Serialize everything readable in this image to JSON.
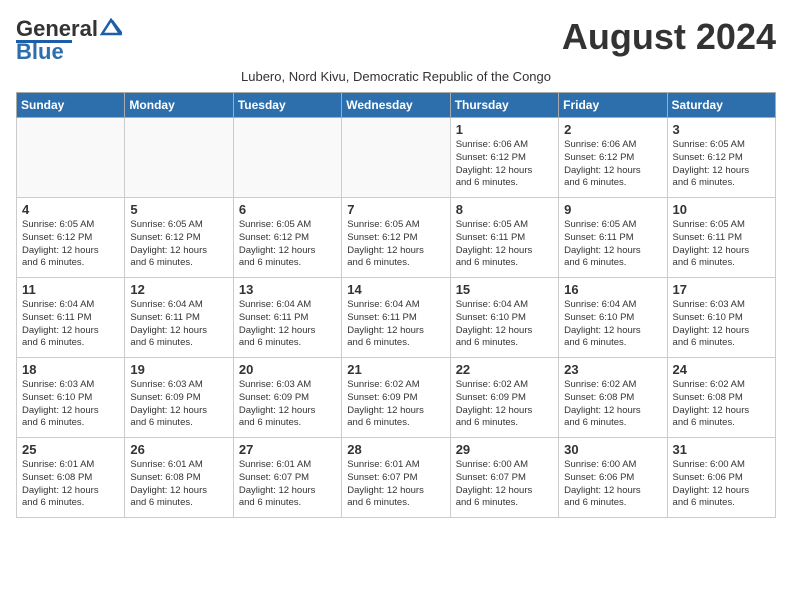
{
  "header": {
    "logo_general": "General",
    "logo_blue": "Blue",
    "month_title": "August 2024",
    "subtitle": "Lubero, Nord Kivu, Democratic Republic of the Congo"
  },
  "calendar": {
    "days_of_week": [
      "Sunday",
      "Monday",
      "Tuesday",
      "Wednesday",
      "Thursday",
      "Friday",
      "Saturday"
    ],
    "weeks": [
      [
        {
          "day": "",
          "content": ""
        },
        {
          "day": "",
          "content": ""
        },
        {
          "day": "",
          "content": ""
        },
        {
          "day": "",
          "content": ""
        },
        {
          "day": "1",
          "content": "Sunrise: 6:06 AM\nSunset: 6:12 PM\nDaylight: 12 hours\nand 6 minutes."
        },
        {
          "day": "2",
          "content": "Sunrise: 6:06 AM\nSunset: 6:12 PM\nDaylight: 12 hours\nand 6 minutes."
        },
        {
          "day": "3",
          "content": "Sunrise: 6:05 AM\nSunset: 6:12 PM\nDaylight: 12 hours\nand 6 minutes."
        }
      ],
      [
        {
          "day": "4",
          "content": "Sunrise: 6:05 AM\nSunset: 6:12 PM\nDaylight: 12 hours\nand 6 minutes."
        },
        {
          "day": "5",
          "content": "Sunrise: 6:05 AM\nSunset: 6:12 PM\nDaylight: 12 hours\nand 6 minutes."
        },
        {
          "day": "6",
          "content": "Sunrise: 6:05 AM\nSunset: 6:12 PM\nDaylight: 12 hours\nand 6 minutes."
        },
        {
          "day": "7",
          "content": "Sunrise: 6:05 AM\nSunset: 6:12 PM\nDaylight: 12 hours\nand 6 minutes."
        },
        {
          "day": "8",
          "content": "Sunrise: 6:05 AM\nSunset: 6:11 PM\nDaylight: 12 hours\nand 6 minutes."
        },
        {
          "day": "9",
          "content": "Sunrise: 6:05 AM\nSunset: 6:11 PM\nDaylight: 12 hours\nand 6 minutes."
        },
        {
          "day": "10",
          "content": "Sunrise: 6:05 AM\nSunset: 6:11 PM\nDaylight: 12 hours\nand 6 minutes."
        }
      ],
      [
        {
          "day": "11",
          "content": "Sunrise: 6:04 AM\nSunset: 6:11 PM\nDaylight: 12 hours\nand 6 minutes."
        },
        {
          "day": "12",
          "content": "Sunrise: 6:04 AM\nSunset: 6:11 PM\nDaylight: 12 hours\nand 6 minutes."
        },
        {
          "day": "13",
          "content": "Sunrise: 6:04 AM\nSunset: 6:11 PM\nDaylight: 12 hours\nand 6 minutes."
        },
        {
          "day": "14",
          "content": "Sunrise: 6:04 AM\nSunset: 6:11 PM\nDaylight: 12 hours\nand 6 minutes."
        },
        {
          "day": "15",
          "content": "Sunrise: 6:04 AM\nSunset: 6:10 PM\nDaylight: 12 hours\nand 6 minutes."
        },
        {
          "day": "16",
          "content": "Sunrise: 6:04 AM\nSunset: 6:10 PM\nDaylight: 12 hours\nand 6 minutes."
        },
        {
          "day": "17",
          "content": "Sunrise: 6:03 AM\nSunset: 6:10 PM\nDaylight: 12 hours\nand 6 minutes."
        }
      ],
      [
        {
          "day": "18",
          "content": "Sunrise: 6:03 AM\nSunset: 6:10 PM\nDaylight: 12 hours\nand 6 minutes."
        },
        {
          "day": "19",
          "content": "Sunrise: 6:03 AM\nSunset: 6:09 PM\nDaylight: 12 hours\nand 6 minutes."
        },
        {
          "day": "20",
          "content": "Sunrise: 6:03 AM\nSunset: 6:09 PM\nDaylight: 12 hours\nand 6 minutes."
        },
        {
          "day": "21",
          "content": "Sunrise: 6:02 AM\nSunset: 6:09 PM\nDaylight: 12 hours\nand 6 minutes."
        },
        {
          "day": "22",
          "content": "Sunrise: 6:02 AM\nSunset: 6:09 PM\nDaylight: 12 hours\nand 6 minutes."
        },
        {
          "day": "23",
          "content": "Sunrise: 6:02 AM\nSunset: 6:08 PM\nDaylight: 12 hours\nand 6 minutes."
        },
        {
          "day": "24",
          "content": "Sunrise: 6:02 AM\nSunset: 6:08 PM\nDaylight: 12 hours\nand 6 minutes."
        }
      ],
      [
        {
          "day": "25",
          "content": "Sunrise: 6:01 AM\nSunset: 6:08 PM\nDaylight: 12 hours\nand 6 minutes."
        },
        {
          "day": "26",
          "content": "Sunrise: 6:01 AM\nSunset: 6:08 PM\nDaylight: 12 hours\nand 6 minutes."
        },
        {
          "day": "27",
          "content": "Sunrise: 6:01 AM\nSunset: 6:07 PM\nDaylight: 12 hours\nand 6 minutes."
        },
        {
          "day": "28",
          "content": "Sunrise: 6:01 AM\nSunset: 6:07 PM\nDaylight: 12 hours\nand 6 minutes."
        },
        {
          "day": "29",
          "content": "Sunrise: 6:00 AM\nSunset: 6:07 PM\nDaylight: 12 hours\nand 6 minutes."
        },
        {
          "day": "30",
          "content": "Sunrise: 6:00 AM\nSunset: 6:06 PM\nDaylight: 12 hours\nand 6 minutes."
        },
        {
          "day": "31",
          "content": "Sunrise: 6:00 AM\nSunset: 6:06 PM\nDaylight: 12 hours\nand 6 minutes."
        }
      ]
    ]
  }
}
